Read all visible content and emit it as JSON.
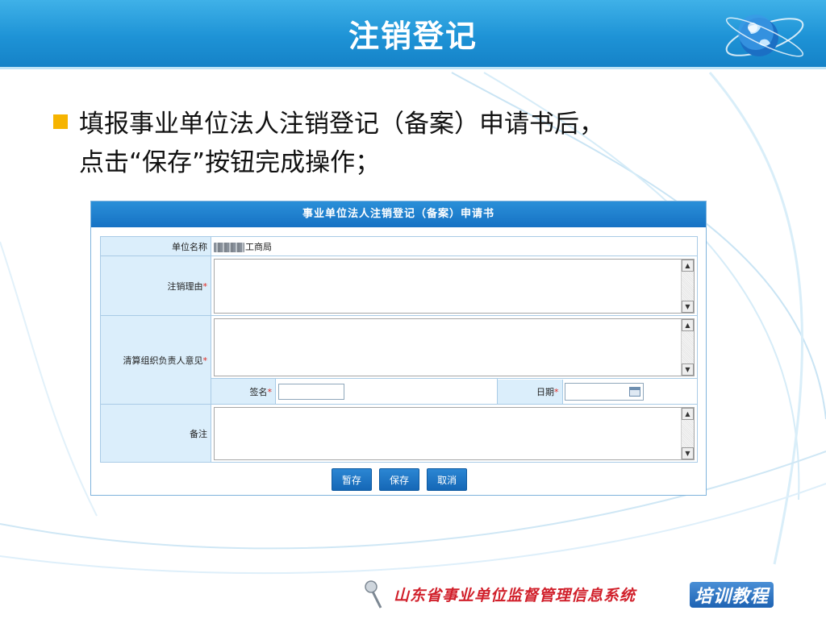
{
  "slide": {
    "title": "注销登记",
    "bullet_line1": "填报事业单位法人注销登记（备案）申请书后，",
    "bullet_line2": "点击“保存”按钮完成操作；"
  },
  "form": {
    "header": "事业单位法人注销登记（备案）申请书",
    "unit_name_label": "单位名称",
    "unit_name_value": "工商局",
    "reason_label": "注销理由",
    "liquidation_label": "清算组织负责人意见",
    "signature_label": "签名",
    "date_label": "日期",
    "remarks_label": "备注",
    "required_mark": "*"
  },
  "buttons": {
    "temp_save": "暂存",
    "save": "保存",
    "cancel": "取消"
  },
  "footer": {
    "system_name": "山东省事业单位监督管理信息系统",
    "tag": "培训教程"
  },
  "colors": {
    "title_bar": "#1e93d6",
    "bullet": "#f6b400",
    "form_header": "#1672c4",
    "label_bg": "#dbeefb",
    "required": "#e0271f",
    "footer_text": "#d1202b"
  },
  "icons": {
    "globe": "globe-icon",
    "calendar": "calendar-icon",
    "pushpin": "pushpin-icon"
  }
}
